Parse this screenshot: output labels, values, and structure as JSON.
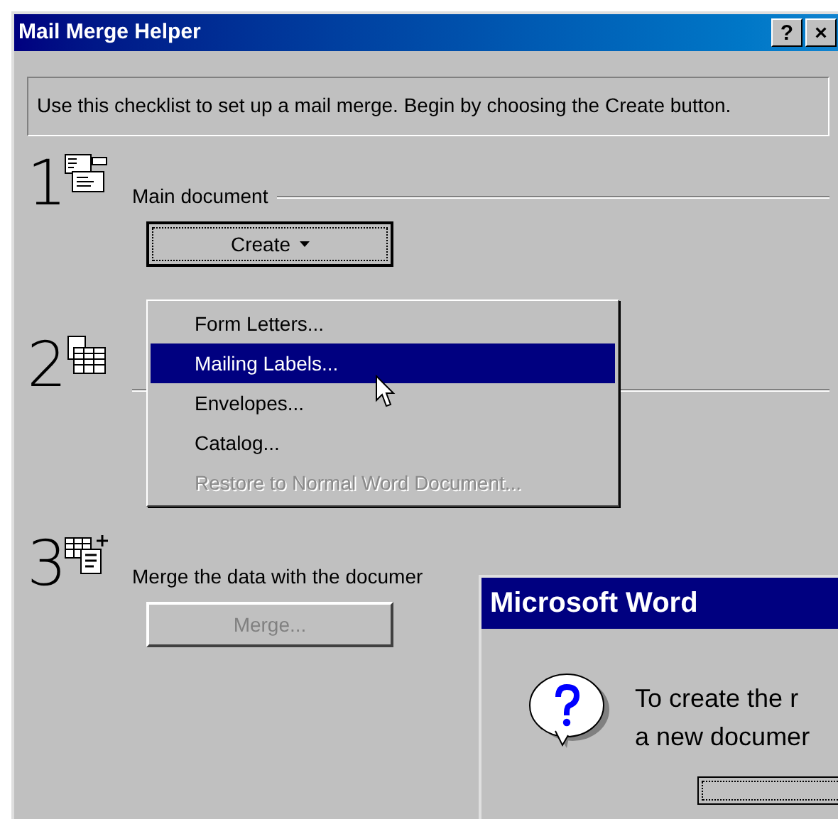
{
  "window": {
    "title": "Mail Merge Helper",
    "title_buttons": [
      "?",
      "×"
    ]
  },
  "instructions": "Use this checklist to set up a mail merge. Begin by choosing the Create button.",
  "steps": [
    {
      "number": "1",
      "label": "Main document",
      "button": {
        "label": "Create",
        "dropdown": true,
        "disabled": false,
        "focused": true
      }
    },
    {
      "number": "2"
    },
    {
      "number": "3",
      "label": "Merge the data with the documer",
      "button": {
        "label": "Merge...",
        "dropdown": false,
        "disabled": true,
        "focused": false
      }
    }
  ],
  "menu": {
    "items": [
      {
        "label": "Form Letters...",
        "selected": false,
        "disabled": false
      },
      {
        "label": "Mailing Labels...",
        "selected": true,
        "disabled": false
      },
      {
        "label": "Envelopes...",
        "selected": false,
        "disabled": false
      },
      {
        "label": "Catalog...",
        "selected": false,
        "disabled": false
      },
      {
        "label": "Restore to Normal Word Document...",
        "selected": false,
        "disabled": true
      }
    ]
  },
  "dialog": {
    "title": "Microsoft Word",
    "message_lines": [
      "To create the r",
      "a new documer"
    ]
  }
}
